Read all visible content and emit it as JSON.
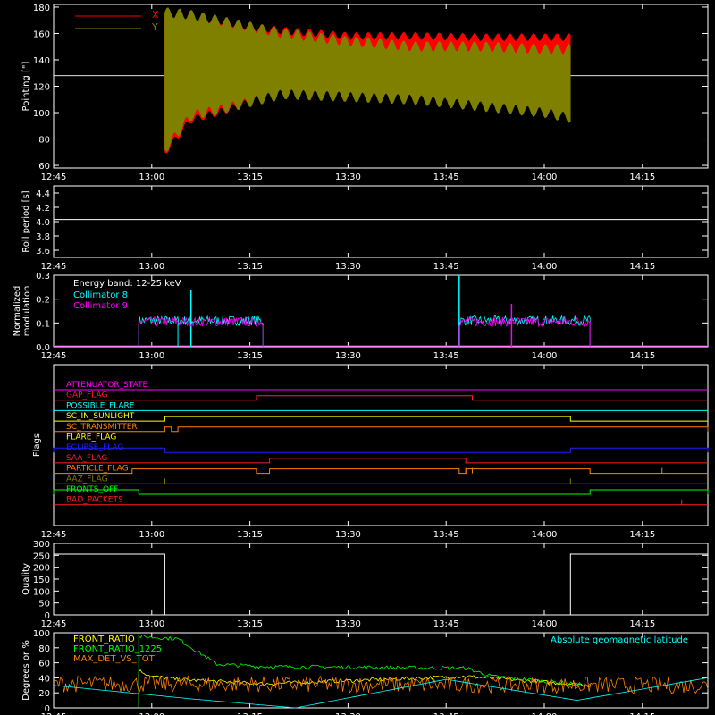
{
  "chart_data": [
    {
      "id": "pointing",
      "type": "line",
      "ylabel": "Pointing [\"]",
      "ylim": [
        58,
        182
      ],
      "yticks": [
        60,
        80,
        100,
        120,
        140,
        160,
        180
      ],
      "xticks": [
        "12:45",
        "13:00",
        "13:15",
        "13:30",
        "13:45",
        "14:00",
        "14:15"
      ],
      "grid": false,
      "legend": {
        "placement": "top-left",
        "items": [
          {
            "name": "X",
            "color": "#ff0000"
          },
          {
            "name": "Y",
            "color": "#808000"
          }
        ]
      },
      "reference_line": 128,
      "series": [
        {
          "name": "X",
          "color": "#ff0000",
          "x": [
            "13:02",
            "13:06",
            "13:10",
            "13:15",
            "13:20",
            "13:30",
            "13:40",
            "13:50",
            "14:00",
            "14:04"
          ],
          "upper": [
            175,
            172,
            170,
            165,
            162,
            158,
            158,
            157,
            157,
            157
          ],
          "lower": [
            70,
            95,
            100,
            108,
            120,
            128,
            130,
            132,
            134,
            135
          ]
        },
        {
          "name": "Y",
          "color": "#808000",
          "x": [
            "13:02",
            "13:06",
            "13:10",
            "13:15",
            "13:20",
            "13:30",
            "13:40",
            "13:50",
            "14:00",
            "14:04"
          ],
          "upper": [
            176,
            174,
            170,
            165,
            160,
            154,
            150,
            150,
            148,
            148
          ],
          "lower": [
            72,
            98,
            102,
            108,
            114,
            112,
            110,
            105,
            100,
            96
          ]
        }
      ]
    },
    {
      "id": "roll",
      "type": "line",
      "ylabel": "Roll period [s]",
      "ylim": [
        3.5,
        4.5
      ],
      "yticks": [
        3.6,
        3.8,
        4.0,
        4.2,
        4.4
      ],
      "xticks": [
        "12:45",
        "13:00",
        "13:15",
        "13:30",
        "13:45",
        "14:00",
        "14:15"
      ],
      "series": [
        {
          "name": "",
          "color": "#ffffff",
          "x": [
            "12:45",
            "14:25"
          ],
          "y": [
            4.03,
            4.03
          ]
        }
      ]
    },
    {
      "id": "modulation",
      "type": "line",
      "ylabel": "Normalized modulation",
      "ylim": [
        0,
        0.3
      ],
      "yticks": [
        0.0,
        0.1,
        0.2,
        0.3
      ],
      "xticks": [
        "12:45",
        "13:00",
        "13:15",
        "13:30",
        "13:45",
        "14:00",
        "14:15"
      ],
      "annotation": "Energy band: 12-25 keV",
      "legend": {
        "placement": "top-left",
        "items": [
          {
            "name": "Collimator 8",
            "color": "#00ffff"
          },
          {
            "name": "Collimator 9",
            "color": "#ff00ff"
          }
        ]
      },
      "active_intervals": [
        [
          "12:58",
          "13:17"
        ],
        [
          "13:47",
          "14:07"
        ]
      ],
      "series": [
        {
          "name": "Collimator 8",
          "color": "#00ffff",
          "mean": 0.11,
          "spikes": [
            {
              "x": "13:06",
              "y": 0.24
            },
            {
              "x": "13:47",
              "y": 0.3
            }
          ]
        },
        {
          "name": "Collimator 9",
          "color": "#ff00ff",
          "mean": 0.105,
          "spikes": [
            {
              "x": "13:55",
              "y": 0.18
            }
          ]
        }
      ]
    },
    {
      "id": "flags",
      "type": "line",
      "ylabel": "Flags",
      "xticks": [
        "12:45",
        "13:00",
        "13:15",
        "13:30",
        "13:45",
        "14:00",
        "14:15"
      ],
      "flags": [
        {
          "name": "ATTENUATOR_STATE",
          "color": "#ff00ff",
          "on": []
        },
        {
          "name": "GAP_FLAG",
          "color": "#ff2020",
          "on": [
            [
              "13:16",
              "13:49"
            ]
          ]
        },
        {
          "name": "POSSIBLE_FLARE",
          "color": "#00ffff",
          "on": []
        },
        {
          "name": "SC_IN_SUNLIGHT",
          "color": "#ffff00",
          "on": [
            [
              "13:02",
              "14:04"
            ]
          ]
        },
        {
          "name": "SC_TRANSMITTER",
          "color": "#ff8000",
          "on": [
            [
              "13:02",
              "13:03"
            ],
            [
              "13:04",
              "14:25"
            ]
          ]
        },
        {
          "name": "FLARE_FLAG",
          "color": "#ffff00",
          "on": []
        },
        {
          "name": "ECLIPSE_FLAG",
          "color": "#2020ff",
          "on": [
            [
              "12:45",
              "13:02"
            ],
            [
              "14:04",
              "14:25"
            ]
          ]
        },
        {
          "name": "SAA_FLAG",
          "color": "#ff2020",
          "on": [
            [
              "13:18",
              "13:48"
            ]
          ]
        },
        {
          "name": "PARTICLE_FLAG",
          "color": "#ff8000",
          "on": [
            [
              "12:57",
              "13:16"
            ],
            [
              "13:18",
              "13:47"
            ],
            [
              "13:48",
              "14:07"
            ]
          ]
        },
        {
          "name": "AAZ_FLAG",
          "color": "#808000",
          "on": []
        },
        {
          "name": "FRONTS_OFF",
          "color": "#00ff00",
          "on": [
            [
              "12:45",
              "12:58"
            ],
            [
              "14:07",
              "14:25"
            ]
          ]
        },
        {
          "name": "BAD_PACKETS",
          "color": "#ff2020",
          "on": []
        }
      ]
    },
    {
      "id": "quality",
      "type": "line",
      "ylabel": "Quality",
      "ylim": [
        0,
        300
      ],
      "yticks": [
        0,
        50,
        100,
        150,
        200,
        250,
        300
      ],
      "xticks": [
        "12:45",
        "13:00",
        "13:15",
        "13:30",
        "13:45",
        "14:00",
        "14:15"
      ],
      "series": [
        {
          "name": "",
          "color": "#ffffff",
          "x": [
            "12:45",
            "13:02",
            "13:02",
            "14:04",
            "14:04",
            "14:25"
          ],
          "y": [
            255,
            255,
            0,
            0,
            255,
            255
          ]
        }
      ]
    },
    {
      "id": "ratios",
      "type": "line",
      "ylabel": "Degrees or %",
      "ylim": [
        0,
        100
      ],
      "yticks": [
        0,
        20,
        40,
        60,
        80,
        100
      ],
      "xticks": [
        "12:45",
        "13:00",
        "13:15",
        "13:30",
        "13:45",
        "14:00",
        "14:15"
      ],
      "annotation": "Absolute geomagnetic latitude",
      "annotation_color": "#00ffff",
      "legend": {
        "placement": "top-left",
        "items": [
          {
            "name": "FRONT_RATIO",
            "color": "#ffff00"
          },
          {
            "name": "FRONT_RATIO_1225",
            "color": "#00ff00"
          },
          {
            "name": "MAX_DET_VS_TOT",
            "color": "#ff8000"
          }
        ]
      },
      "series": [
        {
          "name": "FRONT_RATIO",
          "color": "#ffff00",
          "x": [
            "12:58",
            "13:00",
            "13:04",
            "13:17",
            "13:48",
            "14:07"
          ],
          "y": [
            50,
            42,
            38,
            32,
            42,
            30
          ]
        },
        {
          "name": "FRONT_RATIO_1225",
          "color": "#00ff00",
          "x": [
            "12:58",
            "13:04",
            "13:10",
            "13:17",
            "13:48",
            "13:52",
            "14:07"
          ],
          "y": [
            95,
            92,
            58,
            55,
            53,
            42,
            30
          ]
        },
        {
          "name": "MAX_DET_VS_TOT",
          "color": "#ff8000",
          "x": [
            "12:45",
            "14:25"
          ],
          "y": [
            32,
            30
          ]
        },
        {
          "name": "Absolute geomagnetic latitude",
          "color": "#00ffff",
          "x": [
            "12:45",
            "13:06",
            "13:22",
            "13:45",
            "14:05",
            "14:25"
          ],
          "y": [
            30,
            12,
            0,
            38,
            10,
            40
          ]
        }
      ]
    }
  ]
}
